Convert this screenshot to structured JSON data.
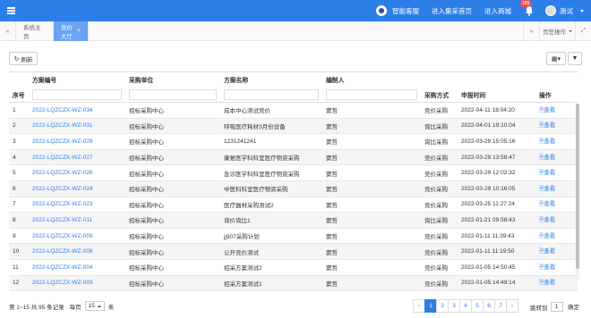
{
  "topbar": {
    "items": [
      "智能客服",
      "进入集采首页",
      "进入商城"
    ],
    "badge": "189",
    "username": "测试",
    "colors": {
      "bar": "#2e7ee8",
      "badge": "#ff4d4f"
    }
  },
  "tabs": {
    "items": [
      "系统主页",
      "竞价大厅"
    ],
    "ops_label": "页签操作"
  },
  "toolbar": {
    "refresh_label": "刷新"
  },
  "table": {
    "headers": {
      "seq": "序号",
      "code": "方案编号",
      "unit": "采购单位",
      "name": "方案名称",
      "author": "编制人",
      "method": "采购方式",
      "time": "申报时间",
      "action": "操作"
    },
    "view_label": "查看",
    "rows": [
      {
        "seq": "1",
        "code": "2022-LQZCZX-WZ-034",
        "unit": "招标采购中心",
        "name": "成本中心测试竞价",
        "author": "窦哲",
        "method": "竞价采购",
        "time": "2022-04-11 18:04:20"
      },
      {
        "seq": "2",
        "code": "2022-LQZCZX-WZ-031",
        "unit": "招标采购中心",
        "name": "呼吸医疗耗材3月份设备",
        "author": "窦哲",
        "method": "询比采购",
        "time": "2022-04-01 19:10:04"
      },
      {
        "seq": "3",
        "code": "2022-LQZCZX-WZ-029",
        "unit": "招标采购中心",
        "name": "1231241241",
        "author": "窦哲",
        "method": "询比采购",
        "time": "2022-03-29 15:05:16"
      },
      {
        "seq": "4",
        "code": "2022-LQZCZX-WZ-027",
        "unit": "招标采购中心",
        "name": "康复医学科科室医疗物资采购",
        "author": "窦哲",
        "method": "竞价采购",
        "time": "2022-03-29 13:58:47"
      },
      {
        "seq": "5",
        "code": "2022-LQZCZX-WZ-026",
        "unit": "招标采购中心",
        "name": "急诊医学科科室医疗物资采购",
        "author": "窦哲",
        "method": "竞价采购",
        "time": "2022-03-29 12:02:32"
      },
      {
        "seq": "6",
        "code": "2022-LQZCZX-WZ-024",
        "unit": "招标采购中心",
        "name": "中医科科室医疗物资采购",
        "author": "窦哲",
        "method": "竞价采购",
        "time": "2022-03-29 10:16:05"
      },
      {
        "seq": "7",
        "code": "2022-LQZCZX-WZ-023",
        "unit": "招标采购中心",
        "name": "医疗器材采购测试2",
        "author": "窦哲",
        "method": "竞价采购",
        "time": "2022-03-25 11:27:24"
      },
      {
        "seq": "8",
        "code": "2022-LQZCZX-WZ-011",
        "unit": "招标采购中心",
        "name": "询价询比1",
        "author": "窦哲",
        "method": "询比采购",
        "time": "2022-01-21 09:58:43"
      },
      {
        "seq": "9",
        "code": "2022-LQZCZX-WZ-009",
        "unit": "招标采购中心",
        "name": "jj907采购计划",
        "author": "窦哲",
        "method": "竞价采购",
        "time": "2022-01-11 11:39:43"
      },
      {
        "seq": "10",
        "code": "2022-LQZCZX-WZ-008",
        "unit": "招标采购中心",
        "name": "公开竞价测试",
        "author": "窦哲",
        "method": "竞价采购",
        "time": "2022-01-11 11:19:50"
      },
      {
        "seq": "11",
        "code": "2022-LQZCZX-WZ-004",
        "unit": "招标采购中心",
        "name": "招采方案测试2",
        "author": "窦哲",
        "method": "竞价采购",
        "time": "2022-01-05 14:50:45"
      },
      {
        "seq": "12",
        "code": "2022-LQZCZX-WZ-003",
        "unit": "招标采购中心",
        "name": "招采方案测试1",
        "author": "窦哲",
        "method": "竞价采购",
        "time": "2022-01-05 14:49:14"
      }
    ]
  },
  "footer": {
    "summary": "第 1~15 共 95 条记录",
    "per_page_label": "每页",
    "page_size": "15",
    "unit": "条",
    "pages": [
      "1",
      "2",
      "3",
      "4",
      "5",
      "6",
      "7"
    ],
    "prev": "‹",
    "next": "›",
    "goto_label": "跳转到",
    "goto_value": "1",
    "confirm": "确定"
  }
}
